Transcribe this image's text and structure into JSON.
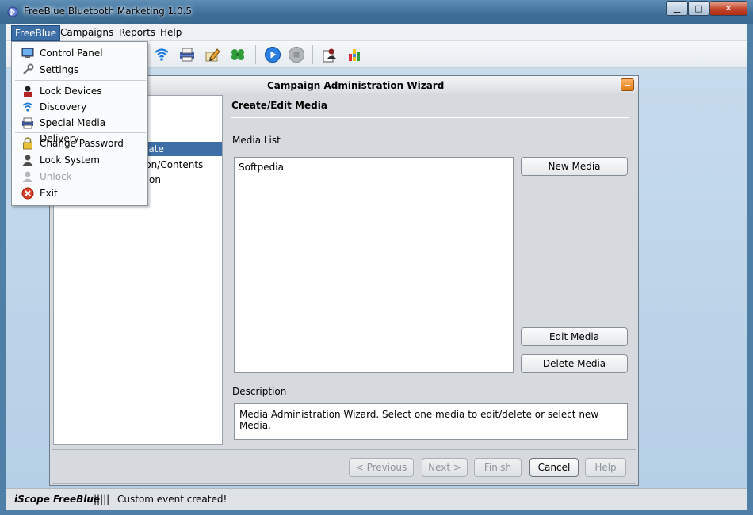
{
  "window": {
    "title": "FreeBlue Bluetooth Marketing 1.0.5",
    "min_glyph": "▁",
    "max_glyph": "□",
    "close_glyph": "✕"
  },
  "menubar": {
    "items": [
      "FreeBlue",
      "Campaigns",
      "Reports",
      "Help"
    ]
  },
  "dropdown": {
    "items": [
      {
        "label": "Control Panel",
        "icon": "monitor-icon"
      },
      {
        "label": "Settings",
        "icon": "wrench-icon"
      },
      {
        "label": "Lock Devices",
        "icon": "lock-devices-icon"
      },
      {
        "label": "Discovery",
        "icon": "wifi-icon"
      },
      {
        "label": "Special Media Delivery",
        "icon": "media-delivery-icon"
      },
      {
        "label": "Change Password",
        "icon": "padlock-icon"
      },
      {
        "label": "Lock System",
        "icon": "user-lock-icon"
      },
      {
        "label": "Unlock",
        "icon": "user-unlock-icon",
        "disabled": true
      },
      {
        "label": "Exit",
        "icon": "exit-icon"
      }
    ]
  },
  "wizard": {
    "title": "Campaign Administration Wizard",
    "steps": [
      "eate",
      "ion/Contents",
      "tion"
    ],
    "section_title": "Create/Edit Media",
    "media_list_label": "Media List",
    "media_items": [
      "Softpedia"
    ],
    "new_media": "New Media",
    "edit_media": "Edit Media",
    "delete_media": "Delete Media",
    "description_label": "Description",
    "description": "Media Administration Wizard. Select one media to edit/delete or select new Media.",
    "footer": {
      "previous": "< Previous",
      "next": "Next >",
      "finish": "Finish",
      "cancel": "Cancel",
      "help": "Help"
    }
  },
  "statusbar": {
    "brand": "iScope FreeBlue",
    "bars": "|||||",
    "message": "Custom event created!"
  },
  "colors": {
    "selection": "#3d6ea5",
    "title_bar": "#4f7ea6"
  }
}
